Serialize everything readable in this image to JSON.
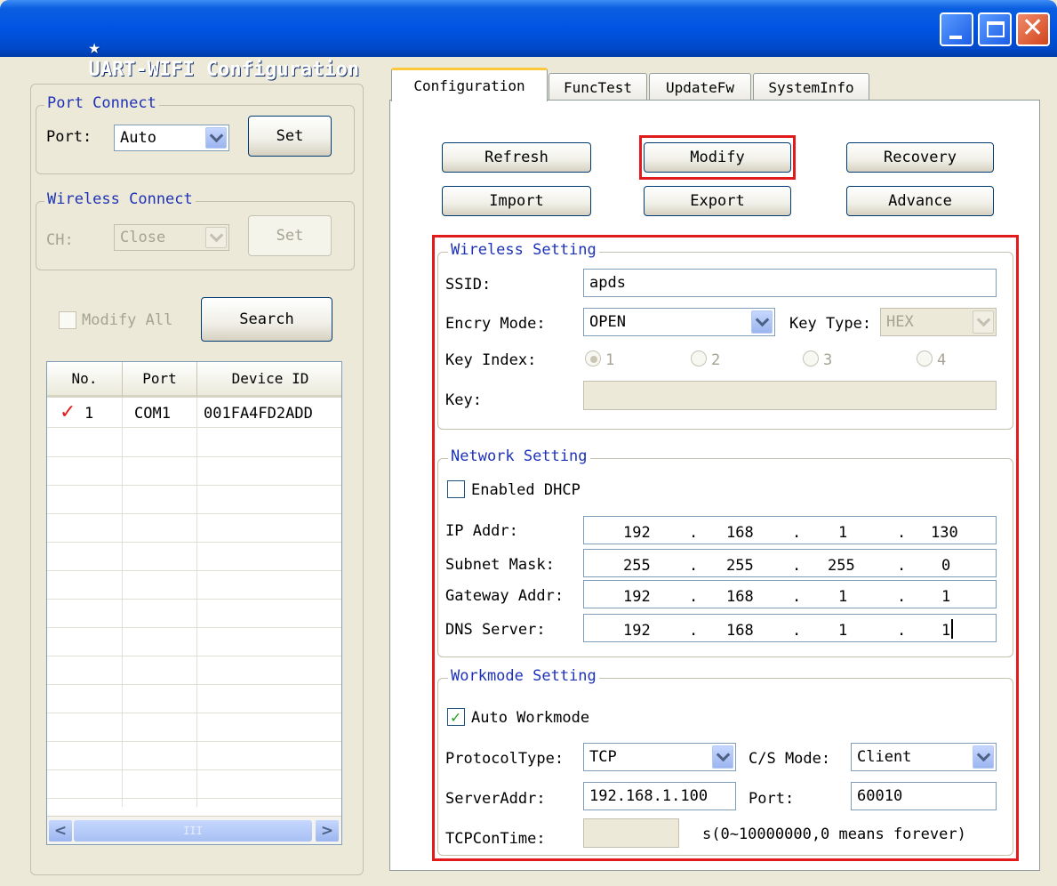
{
  "window": {
    "title": "UART-WIFI Configuration",
    "title_icon": "★"
  },
  "port_connect": {
    "legend": "Port Connect",
    "port_label": "Port:",
    "port_value": "Auto",
    "set_label": "Set"
  },
  "wireless_connect": {
    "legend": "Wireless Connect",
    "ch_label": "CH:",
    "ch_value": "Close",
    "set_label": "Set"
  },
  "modify_all_label": "Modify All",
  "search_label": "Search",
  "device_list": {
    "columns": [
      "No.",
      "Port",
      "Device ID"
    ],
    "rows": [
      {
        "check": "✓",
        "no": "1",
        "port": "COM1",
        "device_id": "001FA4FD2ADD"
      }
    ],
    "scroll_grip": "III"
  },
  "tabs": [
    "Configuration",
    "FuncTest",
    "UpdateFw",
    "SystemInfo"
  ],
  "toolbar": {
    "refresh": "Refresh",
    "modify": "Modify",
    "recovery": "Recovery",
    "import": "Import",
    "export": "Export",
    "advance": "Advance"
  },
  "wireless_setting": {
    "legend": "Wireless Setting",
    "ssid_label": "SSID:",
    "ssid_value": "apds",
    "encry_label": "Encry Mode:",
    "encry_value": "OPEN",
    "keytype_label": "Key Type:",
    "keytype_value": "HEX",
    "keyindex_label": "Key Index:",
    "key_indices": [
      "1",
      "2",
      "3",
      "4"
    ],
    "key_label": "Key:",
    "key_value": ""
  },
  "network_setting": {
    "legend": "Network Setting",
    "dhcp_label": "Enabled DHCP",
    "ip_label": "IP Addr:",
    "ip": [
      "192",
      "168",
      "1",
      "130"
    ],
    "mask_label": "Subnet Mask:",
    "mask": [
      "255",
      "255",
      "255",
      "0"
    ],
    "gw_label": "Gateway Addr:",
    "gw": [
      "192",
      "168",
      "1",
      "1"
    ],
    "dns_label": "DNS Server:",
    "dns": [
      "192",
      "168",
      "1",
      "1"
    ],
    "dot": "."
  },
  "workmode_setting": {
    "legend": "Workmode Setting",
    "auto_label": "Auto Workmode",
    "protocol_label": "ProtocolType:",
    "protocol_value": "TCP",
    "csmode_label": "C/S Mode:",
    "csmode_value": "Client",
    "server_label": "ServerAddr:",
    "server_value": "192.168.1.100",
    "port_label": "Port:",
    "port_value": "60010",
    "tcpcon_label": "TCPConTime:",
    "tcpcon_value": "",
    "tcpcon_hint": "s(0~10000000,0 means forever)"
  },
  "colors": {
    "titlebar": "#0054e3",
    "highlight": "#e11b1b",
    "legend": "#1e32b8",
    "face": "#ece9d8"
  }
}
